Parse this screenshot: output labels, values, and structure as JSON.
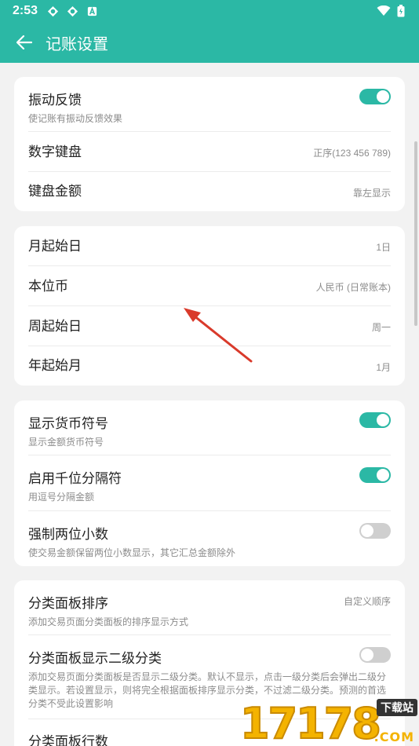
{
  "statusbar": {
    "time": "2:53"
  },
  "appbar": {
    "title": "记账设置"
  },
  "card1": {
    "vibrate": {
      "label": "振动反馈",
      "desc": "使记账有振动反馈效果",
      "on": true
    },
    "keyboard": {
      "label": "数字键盘",
      "value": "正序(123 456 789)"
    },
    "amount": {
      "label": "键盘金额",
      "value": "靠左显示"
    }
  },
  "card2": {
    "month_start": {
      "label": "月起始日",
      "value": "1日"
    },
    "currency": {
      "label": "本位币",
      "value": "人民币 (日常账本)"
    },
    "week_start": {
      "label": "周起始日",
      "value": "周一"
    },
    "year_start": {
      "label": "年起始月",
      "value": "1月"
    }
  },
  "card3": {
    "symbol": {
      "label": "显示货币符号",
      "desc": "显示金额货币符号",
      "on": true
    },
    "thousands": {
      "label": "启用千位分隔符",
      "desc": "用逗号分隔金额",
      "on": true
    },
    "decimals": {
      "label": "强制两位小数",
      "desc": "使交易金额保留两位小数显示，其它汇总金额除外",
      "on": false
    }
  },
  "card4": {
    "sort": {
      "label": "分类面板排序",
      "desc": "添加交易页面分类面板的排序显示方式",
      "value": "自定义顺序"
    },
    "secondary": {
      "label": "分类面板显示二级分类",
      "desc": "添加交易页面分类面板是否显示二级分类。默认不显示，点击一级分类后会弹出二级分类显示。若设置显示，则将完全根据面板排序显示分类，不过滤二级分类。预测的首选分类不受此设置影响",
      "on": false
    },
    "rows": {
      "label": "分类面板行数"
    }
  },
  "watermark": {
    "digits": "17178",
    "tag": "下载站",
    "com": ".COM"
  },
  "colors": {
    "accent": "#2bb8a5",
    "annotation": "#d93a2b"
  }
}
